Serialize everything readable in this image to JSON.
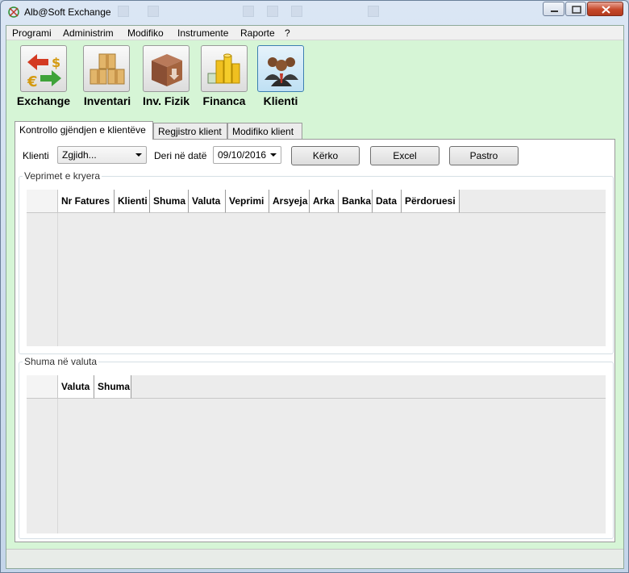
{
  "window": {
    "title": "Alb@Soft Exchange"
  },
  "menu": [
    "Programi",
    "Administrim",
    "Modifiko",
    "Instrumente",
    "Raporte",
    "?"
  ],
  "toolbar": [
    {
      "label": "Exchange",
      "icon": "exchange-icon"
    },
    {
      "label": "Inventari",
      "icon": "inventory-boxes-icon"
    },
    {
      "label": "Inv. Fizik",
      "icon": "physical-inventory-box-icon"
    },
    {
      "label": "Financa",
      "icon": "finance-coins-icon"
    },
    {
      "label": "Klienti",
      "icon": "clients-people-icon",
      "active": true
    }
  ],
  "tabs": [
    {
      "label": "Kontrollo gjëndjen e klientëve",
      "selected": true
    },
    {
      "label": "Regjistro klient",
      "selected": false
    },
    {
      "label": "Modifiko klient",
      "selected": false
    }
  ],
  "filters": {
    "client_label": "Klienti",
    "client_value": "Zgjidh...",
    "date_label": "Deri në datë",
    "date_value": "09/10/2016",
    "search_button": "Kërko",
    "excel_button": "Excel",
    "clear_button": "Pastro"
  },
  "transactions": {
    "title": "Veprimet e kryera",
    "columns": [
      "Nr Fatures",
      "Klienti",
      "Shuma",
      "Valuta",
      "Veprimi",
      "Arsyeja",
      "Arka",
      "Banka",
      "Data",
      "Përdoruesi"
    ],
    "rows": []
  },
  "currency_totals": {
    "title": "Shuma në valuta",
    "columns": [
      "Valuta",
      "Shuma"
    ],
    "rows": []
  },
  "colors": {
    "client_background": "#d6f5d6",
    "close_button": "#c6482a"
  }
}
